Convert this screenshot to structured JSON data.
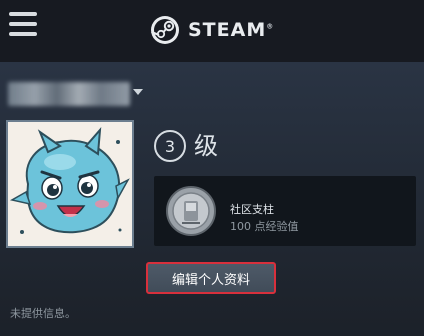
{
  "header": {
    "logo_text": "STEAM",
    "logo_tm": "®",
    "menu_icon": "hamburger-menu-icon",
    "logo_icon": "steam-logo-icon"
  },
  "profile": {
    "username_icon": "blurred-username",
    "level_number": "3",
    "level_label": "级",
    "badge": {
      "name": "社区支柱",
      "xp": "100 点经验值",
      "icon": "community-pillar-badge-icon"
    },
    "edit_button_label": "编辑个人资料",
    "info_text": "未提供信息。"
  },
  "colors": {
    "topbar": "#171a21",
    "background": "#1b2838",
    "highlight_border": "#d8303c"
  }
}
